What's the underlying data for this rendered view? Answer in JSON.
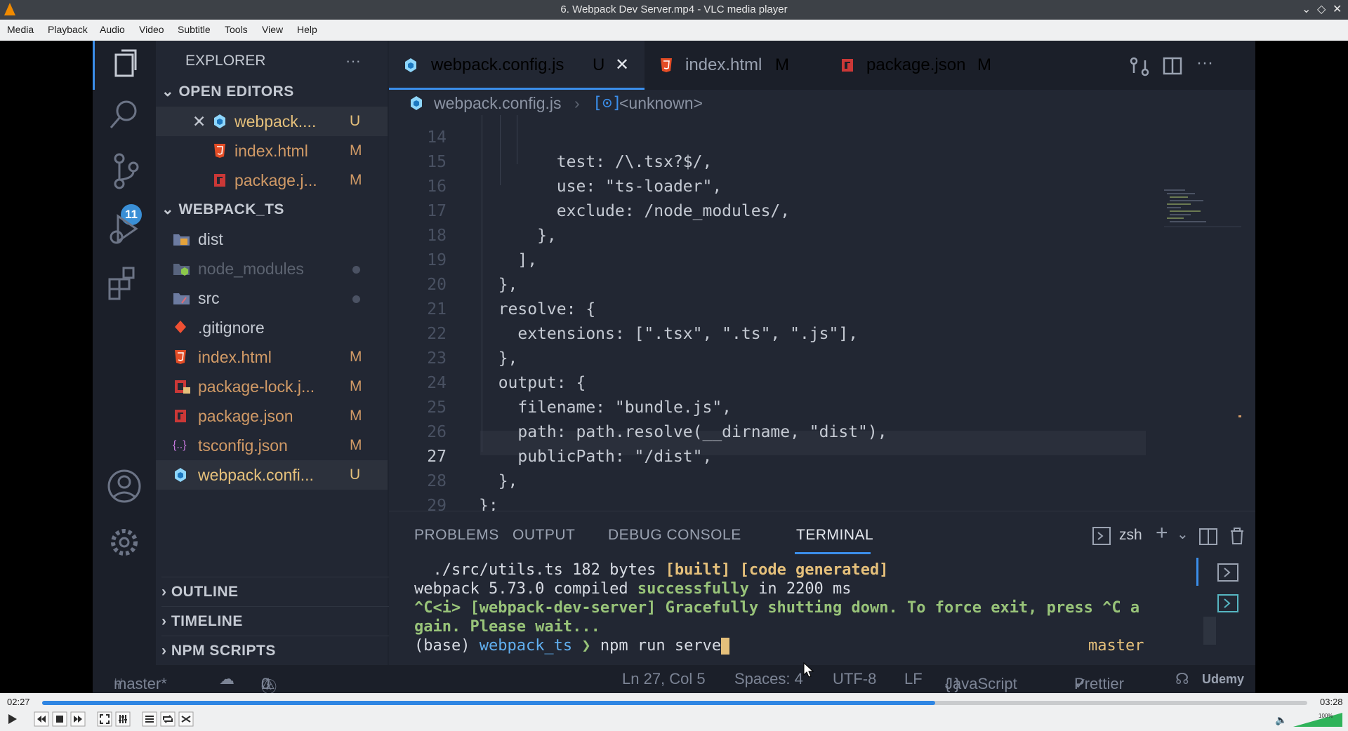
{
  "window": {
    "title": "6. Webpack Dev Server.mp4 - VLC media player"
  },
  "menu": [
    "Media",
    "Playback",
    "Audio",
    "Video",
    "Subtitle",
    "Tools",
    "View",
    "Help"
  ],
  "vscode": {
    "activity_badge": "11",
    "explorer": {
      "title": "EXPLORER",
      "open_editors_header": "OPEN EDITORS",
      "open_editors": [
        {
          "name": "webpack....",
          "status": "U",
          "icon": "webpack-icon",
          "close": "✕"
        },
        {
          "name": "index.html",
          "status": "M",
          "icon": "html5-icon"
        },
        {
          "name": "package.j...",
          "status": "M",
          "icon": "npm-icon"
        }
      ],
      "project_header": "WEBPACK_TS",
      "files": [
        {
          "name": "dist",
          "status": "",
          "icon": "folder-dist-icon"
        },
        {
          "name": "node_modules",
          "status": "",
          "icon": "folder-node-icon"
        },
        {
          "name": "src",
          "status": "",
          "icon": "folder-src-icon"
        },
        {
          "name": ".gitignore",
          "status": "",
          "icon": "git-icon"
        },
        {
          "name": "index.html",
          "status": "M",
          "icon": "html5-icon"
        },
        {
          "name": "package-lock.j...",
          "status": "M",
          "icon": "npm-lock-icon"
        },
        {
          "name": "package.json",
          "status": "M",
          "icon": "npm-icon"
        },
        {
          "name": "tsconfig.json",
          "status": "M",
          "icon": "json-icon"
        },
        {
          "name": "webpack.confi...",
          "status": "U",
          "icon": "webpack-icon"
        }
      ],
      "outline": "OUTLINE",
      "timeline": "TIMELINE",
      "npm_scripts": "NPM SCRIPTS"
    },
    "tabs": [
      {
        "label": "webpack.config.js",
        "status": "U",
        "close": "✕"
      },
      {
        "label": "index.html",
        "status": "M"
      },
      {
        "label": "package.json",
        "status": "M"
      }
    ],
    "breadcrumb": {
      "file": "webpack.config.js",
      "symbol": "<unknown>"
    },
    "code_lines": [
      {
        "n": "14",
        "text": "        test: /\\.tsx?$/,"
      },
      {
        "n": "15",
        "text": "        use: \"ts-loader\","
      },
      {
        "n": "16",
        "text": "        exclude: /node_modules/,"
      },
      {
        "n": "17",
        "text": "      },"
      },
      {
        "n": "18",
        "text": "    ],"
      },
      {
        "n": "19",
        "text": "  },"
      },
      {
        "n": "20",
        "text": "  resolve: {"
      },
      {
        "n": "21",
        "text": "    extensions: [\".tsx\", \".ts\", \".js\"],"
      },
      {
        "n": "22",
        "text": "  },"
      },
      {
        "n": "23",
        "text": "  output: {"
      },
      {
        "n": "24",
        "text": "    filename: \"bundle.js\","
      },
      {
        "n": "25",
        "text": "    path: path.resolve(__dirname, \"dist\"),"
      },
      {
        "n": "26",
        "text": "    publicPath: \"/dist\","
      },
      {
        "n": "27",
        "text": "  },"
      },
      {
        "n": "28",
        "text": "};"
      },
      {
        "n": "29",
        "text": ""
      }
    ],
    "panel": {
      "tabs": [
        "PROBLEMS",
        "OUTPUT",
        "DEBUG CONSOLE",
        "TERMINAL"
      ],
      "shell": "zsh",
      "terminal": {
        "l1_path": "  ./src/utils.ts 182 bytes ",
        "l1_flags": "[built] [code generated]",
        "l2_a": "webpack 5.73.0 compiled ",
        "l2_b": "successfully",
        "l2_c": " in 2200 ms",
        "l3": "^C<i> [webpack-dev-server] Gracefully shutting down. To force exit, press ^C a",
        "l4": "gain. Please wait...",
        "prompt_env": "(base) ",
        "prompt_dir": "webpack_ts",
        "prompt_arrow": " ❯ ",
        "command": "npm run serve",
        "branch": "master"
      }
    },
    "status": {
      "branch": "master*",
      "errors": "0",
      "warnings": "0",
      "position": "Ln 27, Col 5",
      "spaces": "Spaces: 4",
      "encoding": "UTF-8",
      "eol": "LF",
      "language": "JavaScript",
      "formatter": "Prettier",
      "watermark": "Udemy"
    }
  },
  "player": {
    "elapsed": "02:27",
    "total": "03:28",
    "progress_fraction": 0.706,
    "volume": "100%",
    "volume_fraction": 1.0
  }
}
